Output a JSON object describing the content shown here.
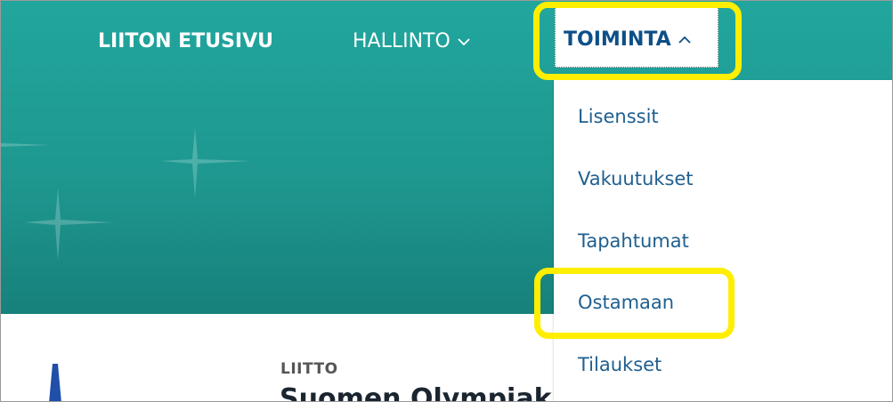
{
  "nav": {
    "home_label": "LIITON ETUSIVU",
    "hallinto_label": "HALLINTO",
    "toiminta_label": "TOIMINTA"
  },
  "dropdown": {
    "items": [
      {
        "label": "Lisenssit"
      },
      {
        "label": "Vakuutukset"
      },
      {
        "label": "Tapahtumat"
      },
      {
        "label": "Ostamaan"
      },
      {
        "label": "Tilaukset"
      }
    ]
  },
  "content": {
    "category": "LIITTO",
    "title": "Suomen Olympiak"
  },
  "colors": {
    "hero_teal": "#1e9890",
    "highlight_yellow": "#ffee00",
    "menu_text_blue": "#1f5f8f",
    "active_nav_blue": "#0d4f88"
  },
  "icons": {
    "hallinto_chevron": "chevron-down-icon",
    "toiminta_chevron": "chevron-up-icon"
  }
}
